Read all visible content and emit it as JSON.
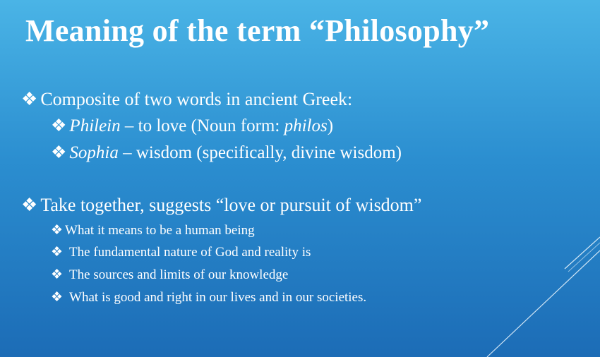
{
  "title": "Meaning of the term “Philosophy”",
  "bullet_glyph": "❖",
  "section1": {
    "heading": "Composite of two words in ancient Greek:",
    "item1": {
      "term": "Philein",
      "text_before": " – to love (Noun form: ",
      "noun": "philos",
      "text_after": ")"
    },
    "item2": {
      "term": "Sophia",
      "text": " – wisdom (specifically, divine wisdom)"
    }
  },
  "section2": {
    "heading": "Take together, suggests “love or pursuit of wisdom”",
    "items": [
      "What it means to be a human being",
      "The fundamental nature of God and reality is",
      "The sources and limits of our knowledge",
      "What is good and right in our lives and in our societies."
    ]
  },
  "colors": {
    "background_top": "#4ab4e6",
    "background_bottom": "#1c6cb6",
    "text": "#ffffff"
  }
}
